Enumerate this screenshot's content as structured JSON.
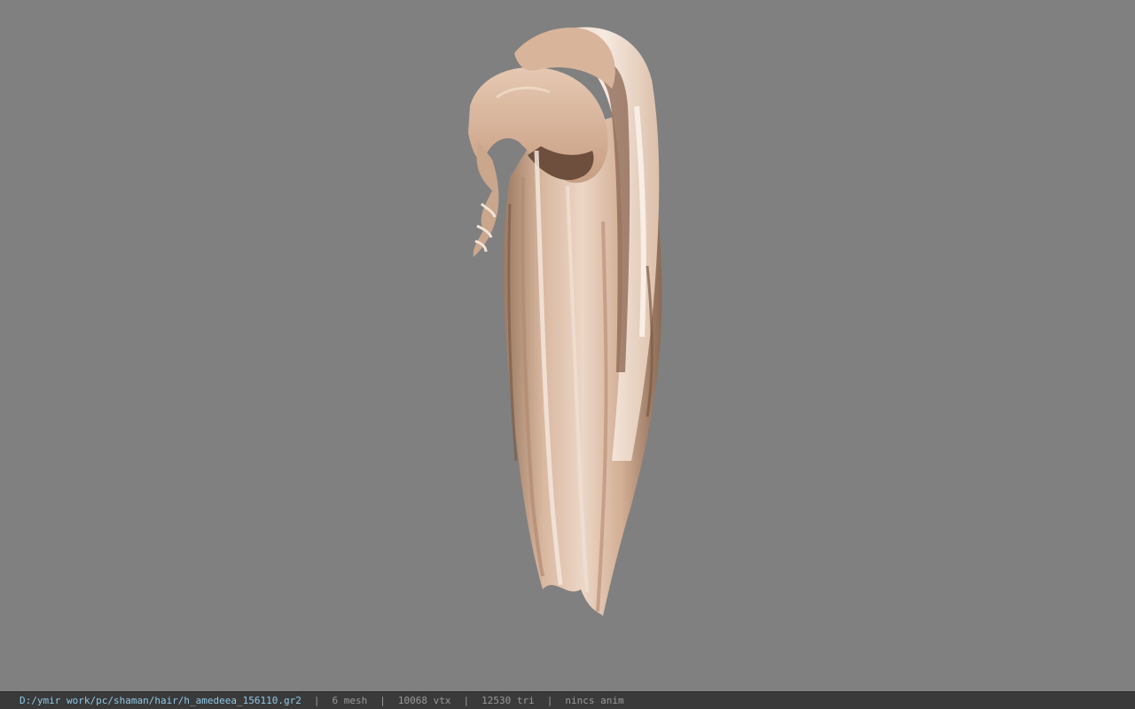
{
  "viewer": {
    "background_color": "#808080",
    "model_description": "hair-model"
  },
  "status_bar": {
    "file_path": "D:/ymir work/pc/shaman/hair/h_amedeea_156110.gr2",
    "mesh_count": "6 mesh",
    "vertex_count": "10068 vtx",
    "triangle_count": "12530 tri",
    "animation": "nincs anim",
    "separator": "|",
    "path_color": "#8fc8e8"
  }
}
